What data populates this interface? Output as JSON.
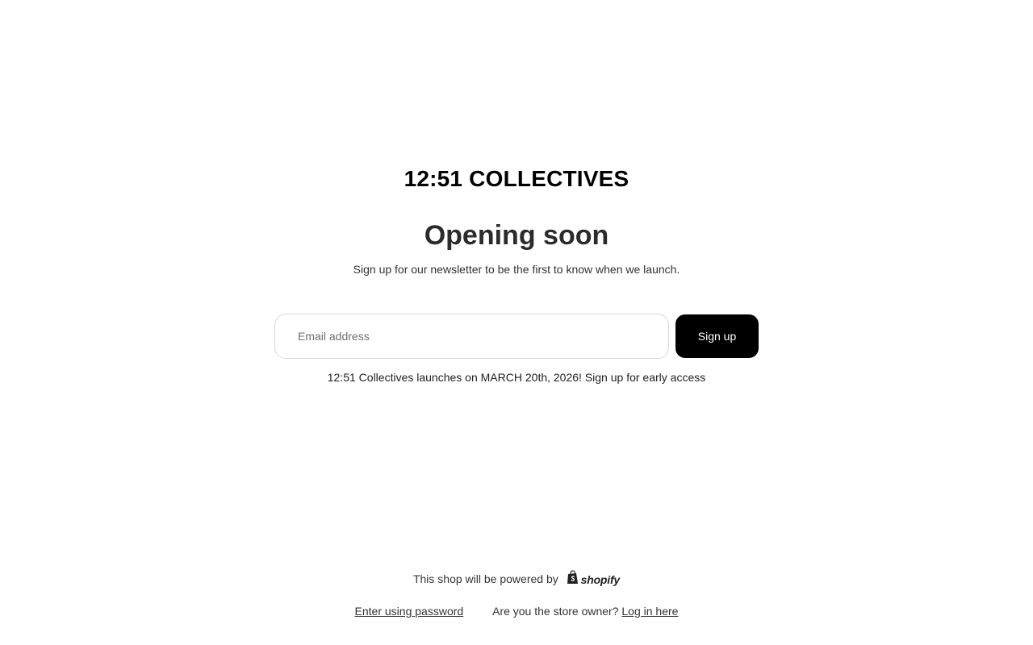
{
  "store": {
    "name": "12:51 COLLECTIVES"
  },
  "hero": {
    "headline": "Opening soon",
    "subtext": "Sign up for our newsletter to be the first to know when we launch."
  },
  "signup": {
    "email_placeholder": "Email address",
    "email_value": "",
    "button_label": "Sign up"
  },
  "launch_note": "12:51 Collectives launches on MARCH 20th, 2026! Sign up for early access",
  "footer": {
    "powered_text": "This shop will be powered by",
    "powered_brand": "shopify",
    "password_link": "Enter using password",
    "owner_question": "Are you the store owner?",
    "login_link": "Log in here"
  },
  "icons": {
    "shopify_bag": "shopify-bag-icon"
  },
  "colors": {
    "button_bg": "#000000",
    "button_text": "#ffffff",
    "input_border": "#d9d9d9"
  }
}
